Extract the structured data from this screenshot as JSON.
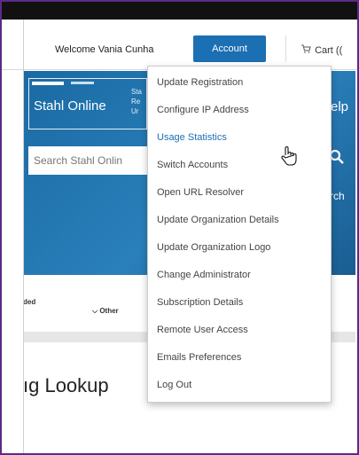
{
  "header": {
    "welcome_text": "Welcome Vania Cunha",
    "account_label": "Account",
    "cart_label": "Cart (("
  },
  "banner": {
    "logo_title": "Stahl Online",
    "logo_subtitle": "Sta Re Ur",
    "help_label": "elp",
    "search_placeholder": "Search Stahl Onlin",
    "search_label": "rch"
  },
  "filters": {
    "filter_left": "ded",
    "filter_right": "Other"
  },
  "page": {
    "heading": "ıg Lookup"
  },
  "account_menu": {
    "items": [
      {
        "label": "Update Registration"
      },
      {
        "label": "Configure IP Address"
      },
      {
        "label": "Usage Statistics"
      },
      {
        "label": "Switch Accounts"
      },
      {
        "label": "Open URL Resolver"
      },
      {
        "label": "Update Organization Details"
      },
      {
        "label": "Update Organization Logo"
      },
      {
        "label": "Change Administrator"
      },
      {
        "label": "Subscription Details"
      },
      {
        "label": "Remote User Access"
      },
      {
        "label": "Emails Preferences"
      },
      {
        "label": "Log Out"
      }
    ],
    "hovered_item": "Usage Statistics"
  },
  "colors": {
    "accent": "#1b6fb3",
    "banner": "#1d6fa8",
    "frame": "#5b2a86"
  }
}
